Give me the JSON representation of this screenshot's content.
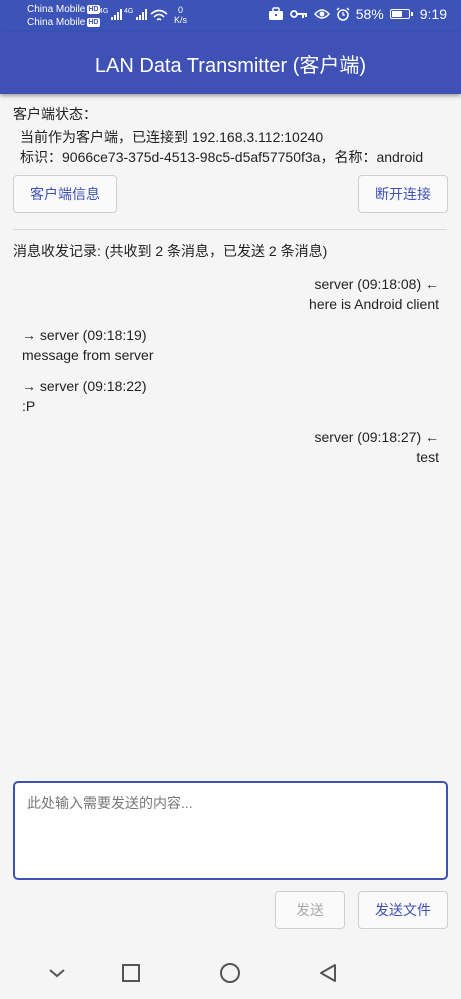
{
  "status_bar": {
    "carrier1": "China Mobile",
    "carrier2": "China Mobile",
    "hd_badge": "HD",
    "network_type": "4G",
    "speed_value": "0",
    "speed_unit": "K/s",
    "battery_percent": "58%",
    "time": "9:19"
  },
  "app_bar": {
    "title": "LAN Data Transmitter (客户端)"
  },
  "client_status": {
    "heading": "客户端状态：",
    "connection": "当前作为客户端，已连接到 192.168.3.112:10240",
    "identity": "标识：9066ce73-375d-4513-98c5-d5af57750f3a，名称：android"
  },
  "buttons": {
    "client_info": "客户端信息",
    "disconnect": "断开连接",
    "send": "发送",
    "send_file": "发送文件"
  },
  "log": {
    "heading": "消息收发记录: (共收到 2 条消息，已发送 2 条消息)",
    "messages": [
      {
        "direction": "sent",
        "header": "server (09:18:08) ←",
        "body": "here is Android client"
      },
      {
        "direction": "received",
        "header": "→ server (09:18:19)",
        "body": "message from server"
      },
      {
        "direction": "received",
        "header": "→ server (09:18:22)",
        "body": ":P"
      },
      {
        "direction": "sent",
        "header": "server (09:18:27) ←",
        "body": "test"
      }
    ]
  },
  "composer": {
    "placeholder": "此处输入需要发送的内容..."
  },
  "nav_icons": [
    "back-chevron-icon",
    "recents-square-icon",
    "home-circle-icon",
    "back-triangle-icon"
  ]
}
